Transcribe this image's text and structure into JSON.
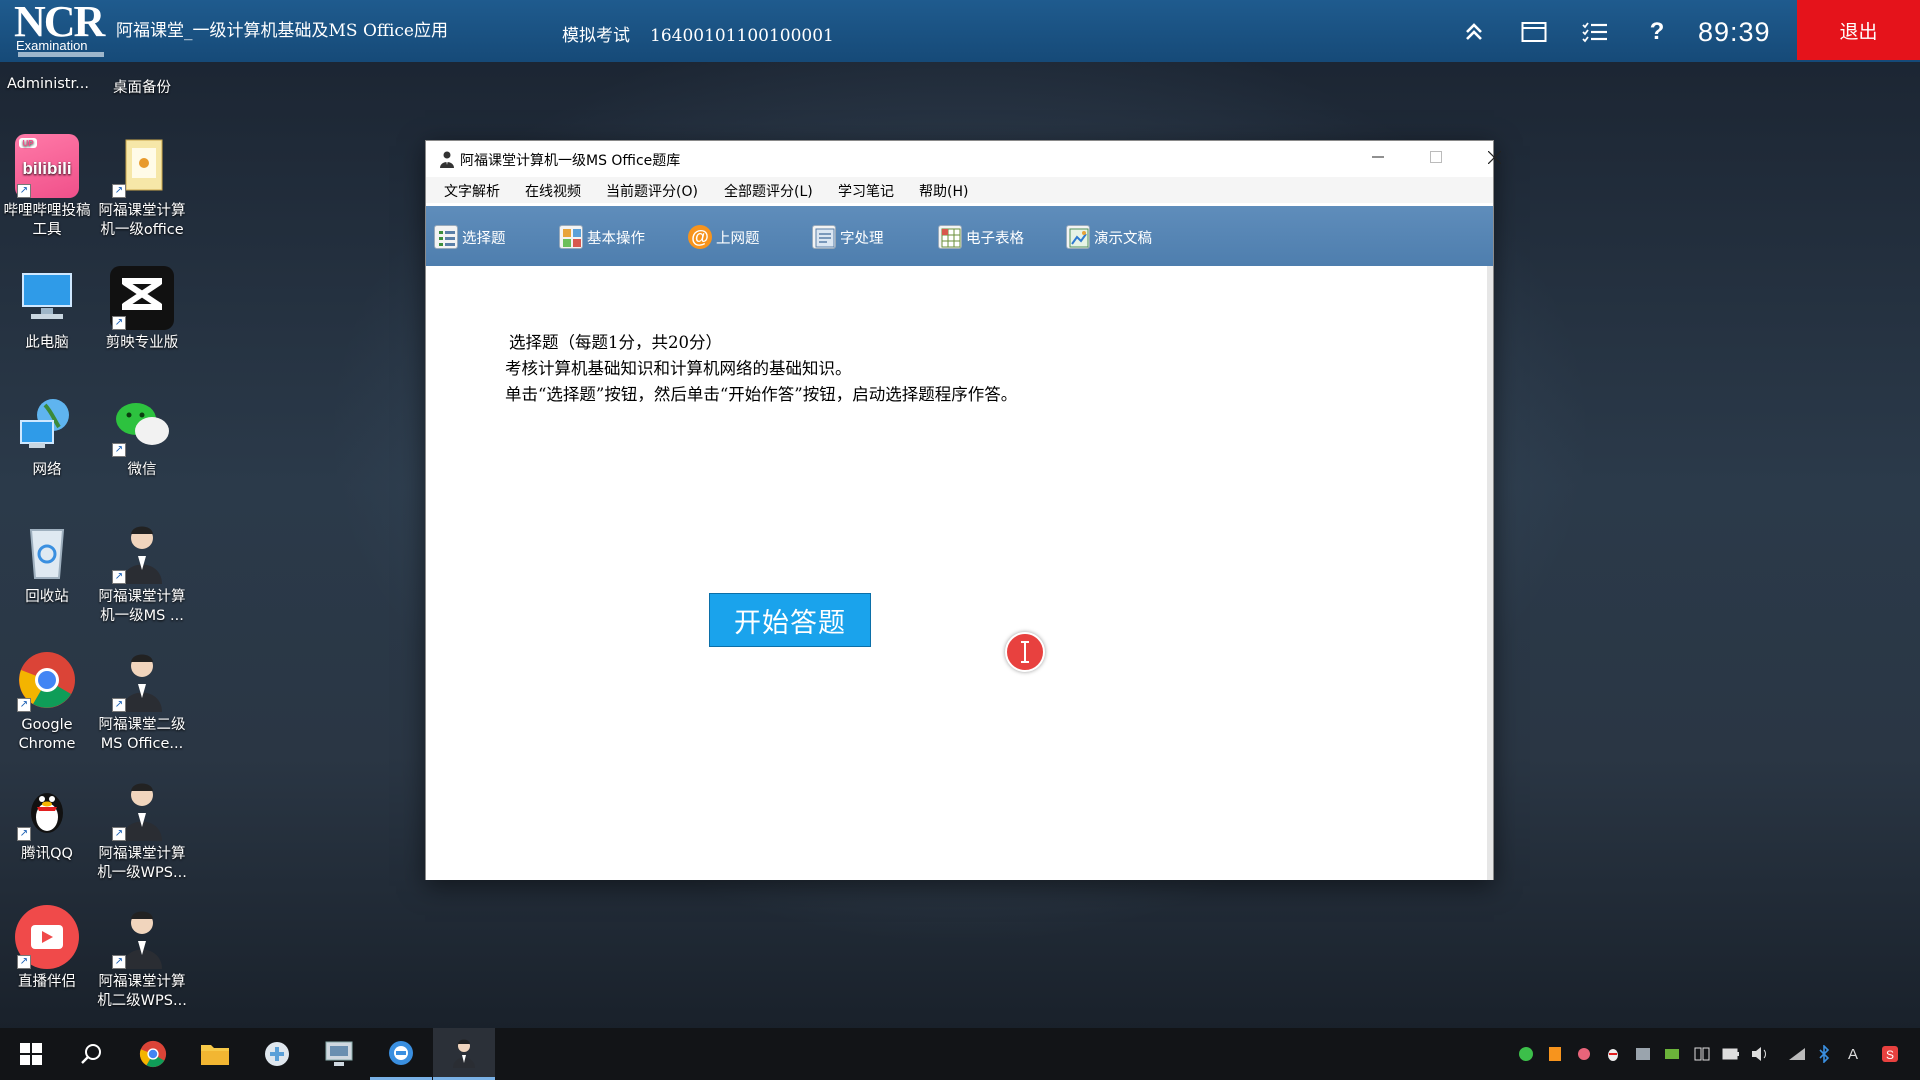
{
  "topbar": {
    "logo_text": "NCR",
    "logo_sub": "Examination",
    "app_title": "阿福课堂_一级计算机基础及MS Office应用",
    "exam_mode": "模拟考试",
    "exam_id": "16400101100100001",
    "timer": "89:39",
    "exit_label": "退出"
  },
  "desktop": {
    "top_labels": [
      "Administr...",
      "桌面备份"
    ],
    "icons": [
      {
        "label": "哔哩哔哩投稿工具"
      },
      {
        "label": "阿福课堂计算机一级office"
      },
      {
        "label": "此电脑"
      },
      {
        "label": "剪映专业版"
      },
      {
        "label": "网络"
      },
      {
        "label": "微信"
      },
      {
        "label": "回收站"
      },
      {
        "label": "阿福课堂计算机一级MS ..."
      },
      {
        "label": "Google Chrome"
      },
      {
        "label": "阿福课堂二级MS Office..."
      },
      {
        "label": "腾讯QQ"
      },
      {
        "label": "阿福课堂计算机一级WPS..."
      },
      {
        "label": "直播伴侣"
      },
      {
        "label": "阿福课堂计算机二级WPS..."
      }
    ]
  },
  "window": {
    "title": "阿福课堂计算机一级MS Office题库",
    "menu": [
      "文字解析",
      "在线视频",
      "当前题评分(O)",
      "全部题评分(L)",
      "学习笔记",
      "帮助(H)"
    ],
    "toolbar": [
      "选择题",
      "基本操作",
      "上网题",
      "字处理",
      "电子表格",
      "演示文稿"
    ],
    "desc_line1": "选择题（每题1分，共20分）",
    "desc_line2": "考核计算机基础知识和计算机网络的基础知识。",
    "desc_line3": "单击“选择题”按钮，然后单击“开始作答”按钮，启动选择题程序作答。",
    "start_button": "开始答题"
  },
  "colors": {
    "topbar": "#1f5b8e",
    "exit": "#e5131b",
    "toolbar": "#5a89b8",
    "start_button": "#1aa3ec"
  }
}
